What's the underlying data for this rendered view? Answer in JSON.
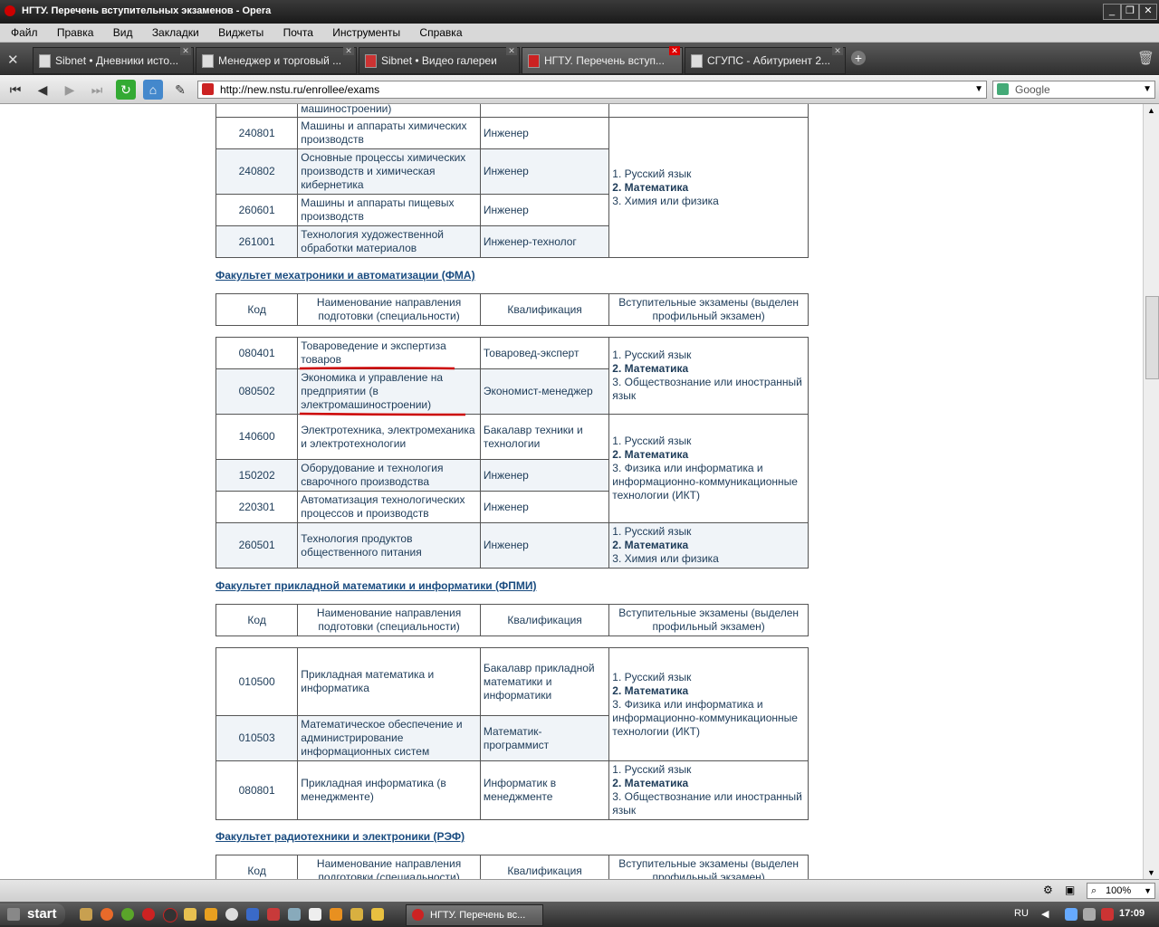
{
  "window": {
    "title": "НГТУ. Перечень вступительных экзаменов - Opera"
  },
  "menu": [
    "Файл",
    "Правка",
    "Вид",
    "Закладки",
    "Виджеты",
    "Почта",
    "Инструменты",
    "Справка"
  ],
  "tabs": [
    {
      "label": "Sibnet • Дневники исто..."
    },
    {
      "label": "Менеджер и торговый ..."
    },
    {
      "label": "Sibnet • Видео галереи"
    },
    {
      "label": "НГТУ. Перечень вступ..."
    },
    {
      "label": "СГУПС - Абитуриент 2..."
    }
  ],
  "address": {
    "url": "http://new.nstu.ru/enrollee/exams",
    "search_engine": "Google"
  },
  "header": {
    "code": "Код",
    "name": "Наименование направления подготовки (специальности)",
    "qual": "Квалификация",
    "exams": "Вступительные экзамены (выделен профильный экзамен)"
  },
  "top_table": {
    "cut_text": "машиностроении)",
    "rows": [
      {
        "code": "240801",
        "name": "Машины и аппараты химических производств",
        "qual": "Инженер"
      },
      {
        "code": "240802",
        "name": "Основные процессы химических производств и химическая кибернетика",
        "qual": "Инженер"
      },
      {
        "code": "260601",
        "name": "Машины и аппараты пищевых производств",
        "qual": "Инженер"
      },
      {
        "code": "261001",
        "name": "Технология художественной обработки материалов",
        "qual": "Инженер-технолог"
      }
    ],
    "exams": [
      "1. Русский язык",
      "2. Математика",
      "3. Химия или физика"
    ]
  },
  "fma": {
    "title": "Факультет мехатроники и автоматизации (ФМА)",
    "rows": [
      {
        "code": "080401",
        "name": "Товароведение и экспертиза товаров",
        "qual": "Товаровед-эксперт"
      },
      {
        "code": "080502",
        "name": "Экономика и управление на предприятии (в электромашиностроении)",
        "qual": "Экономист-менеджер"
      },
      {
        "code": "140600",
        "name": "Электротехника, электромеханика и электротехнологии",
        "qual": "Бакалавр техники и технологии"
      },
      {
        "code": "150202",
        "name": "Оборудование и технология сварочного производства",
        "qual": "Инженер"
      },
      {
        "code": "220301",
        "name": "Автоматизация технологических процессов и производств",
        "qual": "Инженер"
      },
      {
        "code": "260501",
        "name": "Технология продуктов общественного питания",
        "qual": "Инженер"
      }
    ],
    "exams1": [
      "1. Русский язык",
      "2. Математика",
      "3. Обществознание или иностранный язык"
    ],
    "exams2": [
      "1. Русский язык",
      "2. Математика",
      "3. Физика или информатика и информационно-коммуникационные технологии (ИКТ)"
    ],
    "exams3": [
      "1. Русский язык",
      "2. Математика",
      "3. Химия или физика"
    ]
  },
  "fpmi": {
    "title": "Факультет прикладной математики и информатики (ФПМИ)",
    "rows": [
      {
        "code": "010500",
        "name": "Прикладная математика и информатика",
        "qual": "Бакалавр прикладной математики и информатики"
      },
      {
        "code": "010503",
        "name": "Математическое обеспечение и администрирование информационных систем",
        "qual": "Математик-программист"
      },
      {
        "code": "080801",
        "name": "Прикладная информатика (в менеджменте)",
        "qual": "Информатик в менеджменте"
      }
    ],
    "exams1": [
      "1. Русский язык",
      "2. Математика",
      "3. Физика или информатика и информационно-коммуникационные технологии (ИКТ)"
    ],
    "exams2": [
      "1. Русский язык",
      "2. Математика",
      "3. Обществознание или иностранный язык"
    ]
  },
  "ref": {
    "title": "Факультет радиотехники и электроники (РЭФ)"
  },
  "status": {
    "zoom": "100%"
  },
  "taskbar": {
    "start": "start",
    "task": "НГТУ. Перечень вс...",
    "lang": "RU",
    "time": "17:09"
  },
  "colors": {
    "link": "#1a4c80",
    "text": "#1d3b58",
    "underline": "#cc0000"
  }
}
